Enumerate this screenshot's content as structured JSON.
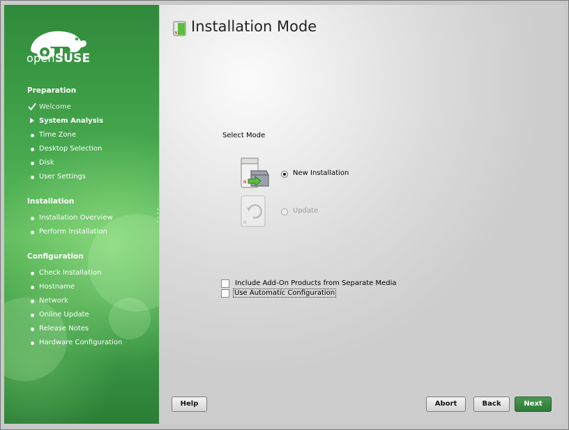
{
  "logo": {
    "text_open": "open",
    "text_suse": "SUSE"
  },
  "sidebar": {
    "sections": [
      {
        "title": "Preparation",
        "steps": [
          {
            "label": "Welcome",
            "state": "done"
          },
          {
            "label": "System Analysis",
            "state": "current"
          },
          {
            "label": "Time Zone",
            "state": "pending"
          },
          {
            "label": "Desktop Selection",
            "state": "pending"
          },
          {
            "label": "Disk",
            "state": "pending"
          },
          {
            "label": "User Settings",
            "state": "pending"
          }
        ]
      },
      {
        "title": "Installation",
        "steps": [
          {
            "label": "Installation Overview",
            "state": "pending"
          },
          {
            "label": "Perform Installation",
            "state": "pending"
          }
        ]
      },
      {
        "title": "Configuration",
        "steps": [
          {
            "label": "Check Installation",
            "state": "pending"
          },
          {
            "label": "Hostname",
            "state": "pending"
          },
          {
            "label": "Network",
            "state": "pending"
          },
          {
            "label": "Online Update",
            "state": "pending"
          },
          {
            "label": "Release Notes",
            "state": "pending"
          },
          {
            "label": "Hardware Configuration",
            "state": "pending"
          }
        ]
      }
    ]
  },
  "main": {
    "title": "Installation Mode",
    "select_mode_label": "Select Mode",
    "modes": [
      {
        "label": "New Installation",
        "selected": true,
        "enabled": true,
        "icon": "new-installation-icon"
      },
      {
        "label": "Update",
        "selected": false,
        "enabled": false,
        "icon": "update-icon"
      }
    ],
    "checkboxes": [
      {
        "label": "Include Add-On Products from Separate Media",
        "checked": false
      },
      {
        "label": "Use Automatic Configuration",
        "checked": false
      }
    ]
  },
  "buttons": {
    "help": "Help",
    "abort": "Abort",
    "back": "Back",
    "next": "Next"
  },
  "colors": {
    "sidebar_green": "#46a84e",
    "next_button": "#2c7a36"
  }
}
